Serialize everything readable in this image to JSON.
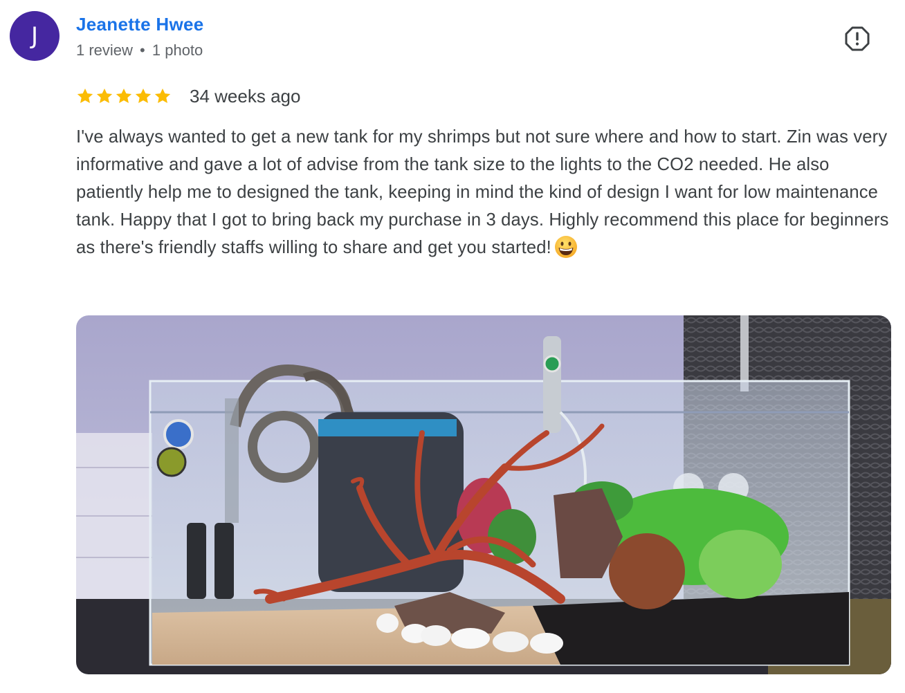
{
  "author": {
    "initial": "J",
    "name": "Jeanette Hwee",
    "review_count": "1 review",
    "separator": "•",
    "photo_count": "1 photo",
    "avatar_color": "#4527a0"
  },
  "actions": {
    "flag_icon": "report-flag-icon"
  },
  "review": {
    "rating": 5,
    "rating_max": 5,
    "star_color": "#fbbc04",
    "date": "34 weeks ago",
    "text": "I've always wanted to get a new tank for my shrimps but not sure where and how to start. Zin was very informative and gave a lot of advise from the tank size to the lights to the CO2 needed. He also patiently help me to designed the tank, keeping in mind the kind of design I want for low maintenance tank. Happy that I got to bring back my purchase in 3 days. Highly recommend this place for beginners as there's friendly staffs willing to share and get you started!",
    "emoji": "grinning-face-emoji"
  },
  "photo": {
    "subject": "aquarium-photo"
  },
  "colors": {
    "link_blue": "#1a73e8",
    "text_gray": "#3c4043",
    "meta_gray": "#5f6368"
  }
}
